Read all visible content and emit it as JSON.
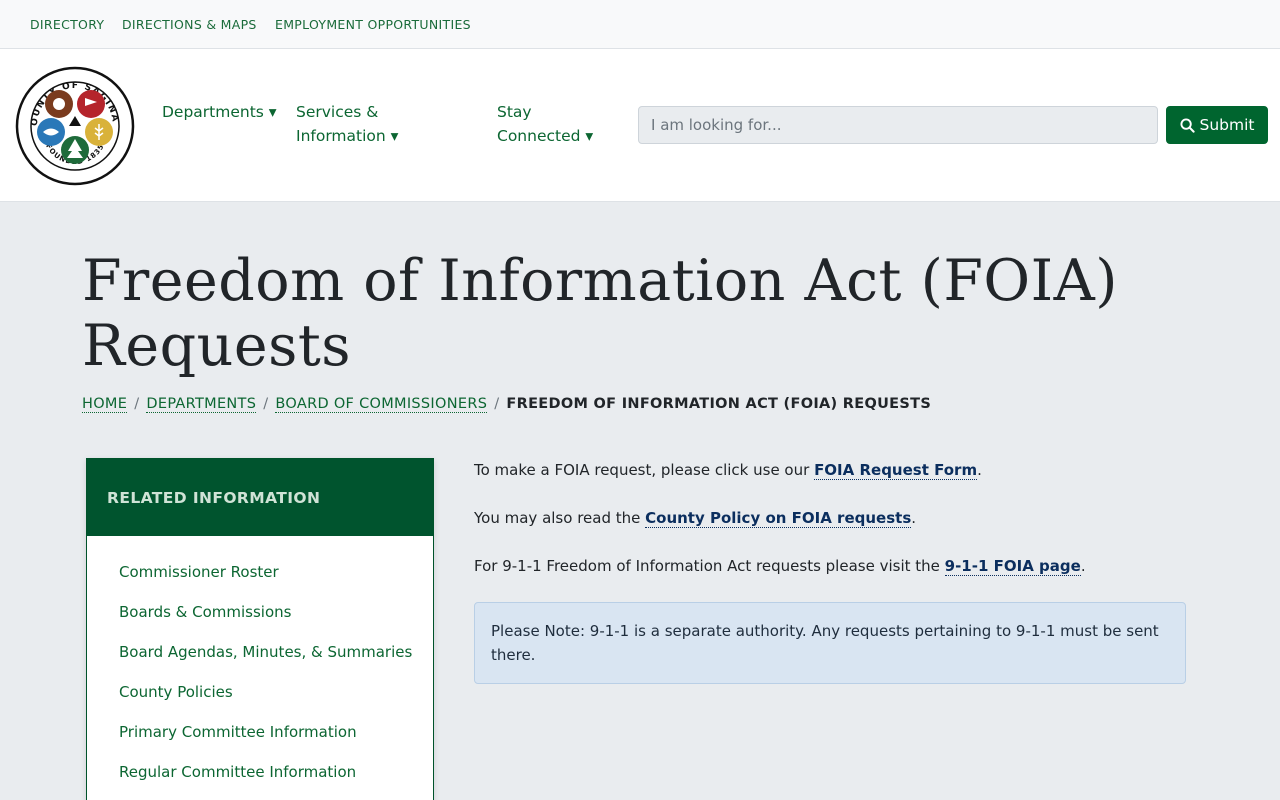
{
  "topbar": {
    "links": [
      "DIRECTORY",
      "DIRECTIONS & MAPS",
      "EMPLOYMENT OPPORTUNITIES"
    ]
  },
  "header": {
    "logo": {
      "top_text": "COUNTY OF SAGINAW",
      "bottom_text": "FOUNDED 1835",
      "colors": [
        "#7a3b1e",
        "#b5242b",
        "#2a78b8",
        "#1e6b3a",
        "#d9b23a"
      ]
    },
    "nav": [
      {
        "label": "Departments ▾"
      },
      {
        "line1": "Services &",
        "line2": "Information ▾"
      },
      {
        "line1": "Stay",
        "line2": "Connected ▾"
      }
    ],
    "search": {
      "placeholder": "I am looking for...",
      "submit_label": "Submit",
      "submit_icon": "search-icon"
    }
  },
  "page": {
    "title_line1": "Freedom of Information Act (FOIA)",
    "title_line2": "Requests"
  },
  "breadcrumb": {
    "items": [
      "HOME",
      "DEPARTMENTS",
      "BOARD OF COMMISSIONERS"
    ],
    "separator": "/",
    "current": "FREEDOM OF INFORMATION ACT (FOIA) REQUESTS"
  },
  "sidebar": {
    "heading": "RELATED INFORMATION",
    "items": [
      "Commissioner Roster",
      "Boards & Commissions",
      "Board Agendas, Minutes, & Summaries",
      "County Policies",
      "Primary Committee Information",
      "Regular Committee Information"
    ]
  },
  "content": {
    "p1": {
      "before": "To make a FOIA request, please click use our ",
      "link": "FOIA Request Form",
      "after": "."
    },
    "p2": {
      "before": "You may also read the ",
      "link": "County Policy on FOIA requests",
      "after": "."
    },
    "p3": {
      "before": "For 9-1-1 Freedom of Information Act requests please visit the ",
      "link": "9-1-1 FOIA page",
      "after": "."
    },
    "note": "Please Note: 9-1-1 is a separate authority. Any requests pertaining to 9-1-1 must be sent there."
  },
  "colors": {
    "brand_green": "#00652f",
    "sidebar_header": "#00542e",
    "link_green": "#0c6632",
    "link_navy": "#0b2e5e",
    "note_bg": "#d9e5f2",
    "page_bg": "#e9ecef"
  }
}
